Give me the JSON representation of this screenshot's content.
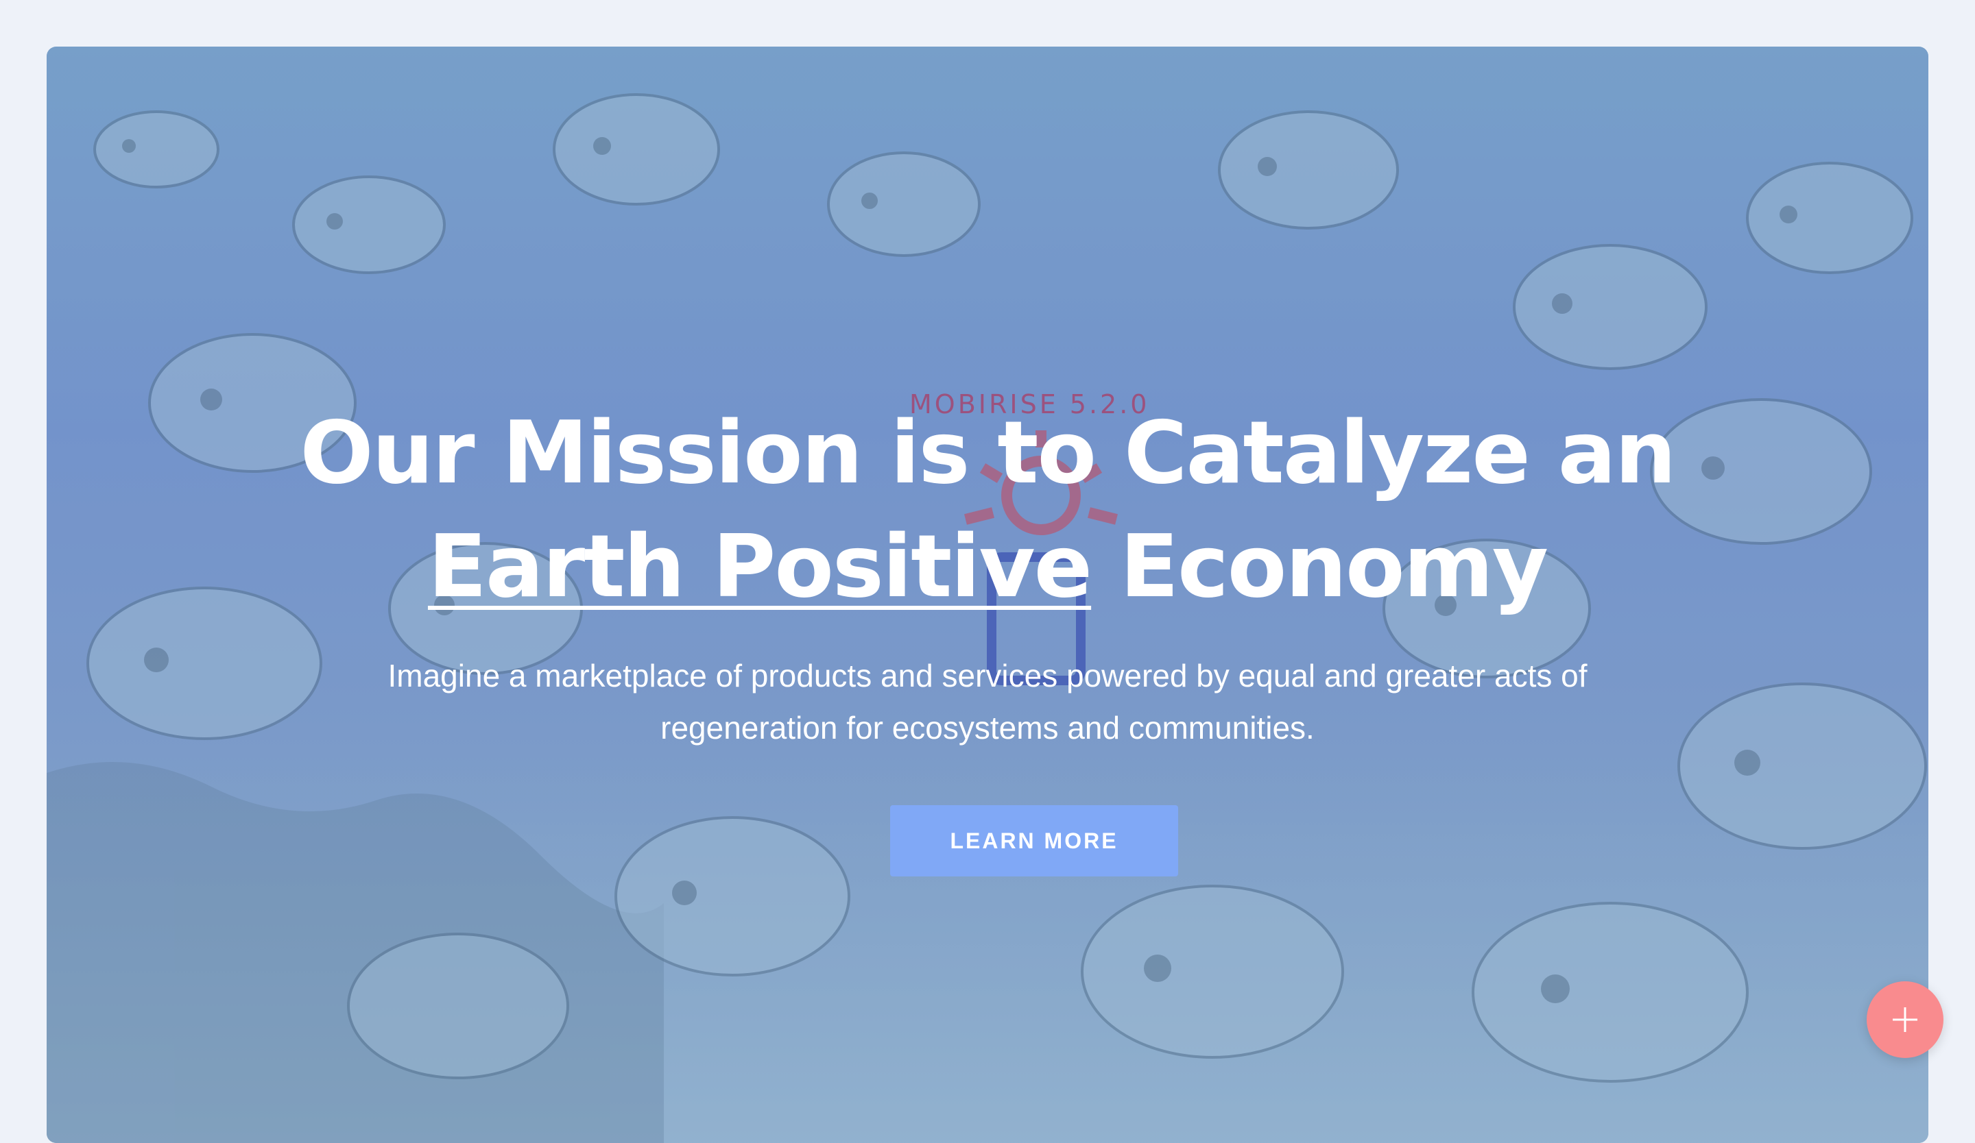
{
  "hero": {
    "watermark": "MOBIRISE 5.2.0",
    "headline_line1": "Our Mission is to Catalyze an",
    "headline_underlined": "Earth Positive",
    "headline_rest": " Economy",
    "subtitle": "Imagine a marketplace of products and services powered by equal and greater acts of regeneration for ecosystems and communities.",
    "button_label": "LEARN MORE"
  },
  "fab": {
    "icon": "plus-icon"
  },
  "colors": {
    "page_background": "#eef2f9",
    "button": "#80a8f6",
    "fab": "#f98b8e",
    "headline": "#ffffff"
  }
}
